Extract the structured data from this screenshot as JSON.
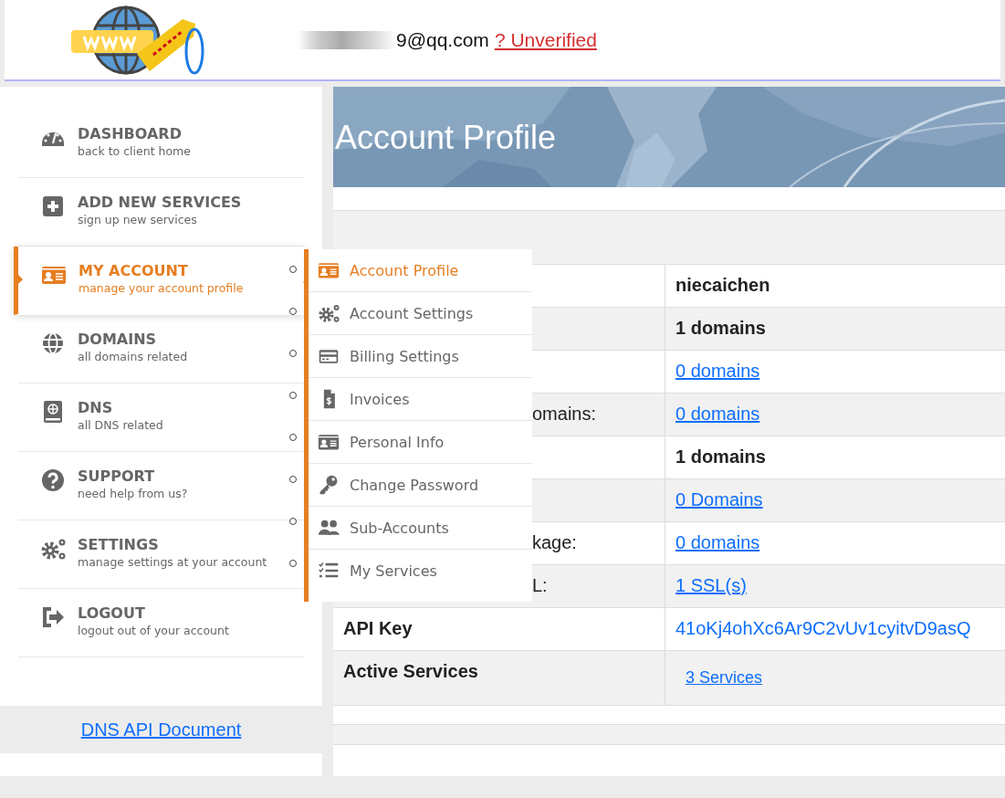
{
  "header": {
    "email": "9@qq.com",
    "verify_link": "? Unverified"
  },
  "sidebar": {
    "items": [
      {
        "title": "DASHBOARD",
        "subtitle": "back to client home",
        "selected": false
      },
      {
        "title": "ADD NEW SERVICES",
        "subtitle": "sign up new services",
        "selected": false
      },
      {
        "title": "MY ACCOUNT",
        "subtitle": "manage your account profile",
        "selected": true
      },
      {
        "title": "DOMAINS",
        "subtitle": "all domains related",
        "selected": false
      },
      {
        "title": "DNS",
        "subtitle": "all DNS related",
        "selected": false
      },
      {
        "title": "SUPPORT",
        "subtitle": "need help from us?",
        "selected": false
      },
      {
        "title": "SETTINGS",
        "subtitle": "manage settings at your account",
        "selected": false
      },
      {
        "title": "LOGOUT",
        "subtitle": "logout out of your account",
        "selected": false
      }
    ],
    "doc_link": "DNS API Document"
  },
  "submenu": [
    {
      "label": "Account Profile",
      "selected": true
    },
    {
      "label": "Account Settings",
      "selected": false
    },
    {
      "label": "Billing Settings",
      "selected": false
    },
    {
      "label": "Invoices",
      "selected": false
    },
    {
      "label": "Personal Info",
      "selected": false
    },
    {
      "label": "Change Password",
      "selected": false
    },
    {
      "label": "Sub-Accounts",
      "selected": false
    },
    {
      "label": "My Services",
      "selected": false
    }
  ],
  "page_title": "Account Profile",
  "table": {
    "rows": [
      {
        "value": "niecaichen",
        "kind": "text"
      },
      {
        "value": "1 domains",
        "kind": "text"
      },
      {
        "value": "0 domains",
        "kind": "link"
      },
      {
        "label": "omains:",
        "value": "0 domains",
        "kind": "link"
      },
      {
        "value": "1 domains",
        "kind": "text"
      },
      {
        "value": "0 Domains",
        "kind": "link"
      },
      {
        "label": "kage:",
        "value": "0 domains",
        "kind": "link"
      },
      {
        "label": "L:",
        "value": "1 SSL(s)",
        "kind": "link"
      },
      {
        "label": "API Key",
        "value": "41oKj4ohXc6Ar9C2vUv1cyitvD9asQ",
        "kind": "key"
      },
      {
        "label": "Active Services",
        "value": "3 Services",
        "kind": "small-link"
      }
    ]
  }
}
